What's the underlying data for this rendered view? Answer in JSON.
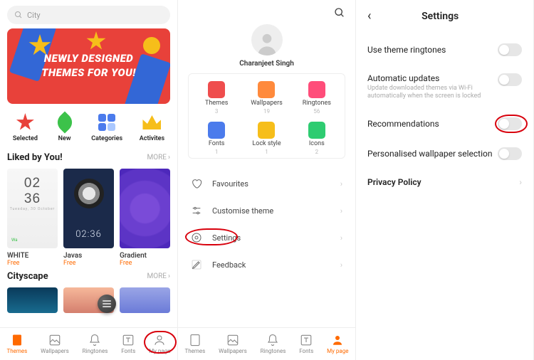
{
  "panel1": {
    "search_placeholder": "City",
    "banner_line1": "Newly Designed",
    "banner_line2": "Themes For You!",
    "quick": [
      "Selected",
      "New",
      "Categories",
      "Activites"
    ],
    "section1": {
      "title": "Liked by You!",
      "more": "MORE"
    },
    "themes": [
      {
        "name": "WHITE",
        "price": "Free",
        "clock": "02\n36",
        "day": "Tuesday, 30 October"
      },
      {
        "name": "Javas",
        "price": "Free",
        "time": "02:36"
      },
      {
        "name": "Gradient",
        "price": "Free"
      }
    ],
    "section2": {
      "title": "Cityscape",
      "more": "MORE"
    },
    "nav": [
      "Themes",
      "Wallpapers",
      "Ringtones",
      "Fonts",
      "My page"
    ]
  },
  "panel2": {
    "user_name": "Charanjeet Singh",
    "stats": [
      {
        "label": "Themes",
        "count": "3"
      },
      {
        "label": "Wallpapers",
        "count": "19"
      },
      {
        "label": "Ringtones",
        "count": "56"
      },
      {
        "label": "Fonts",
        "count": "1"
      },
      {
        "label": "Lock style",
        "count": "1"
      },
      {
        "label": "Icons",
        "count": "2"
      }
    ],
    "menu": [
      "Favourites",
      "Customise theme",
      "Settings",
      "Feedback"
    ],
    "nav": [
      "Themes",
      "Wallpapers",
      "Ringtones",
      "Fonts",
      "My page"
    ]
  },
  "panel3": {
    "title": "Settings",
    "rows": [
      {
        "label": "Use theme ringtones"
      },
      {
        "label": "Automatic updates",
        "sub": "Update downloaded themes via Wi-Fi automatically when the screen is locked"
      },
      {
        "label": "Recommendations"
      },
      {
        "label": "Personalised wallpaper selection"
      },
      {
        "label": "Privacy Policy",
        "chevron": true
      }
    ]
  }
}
